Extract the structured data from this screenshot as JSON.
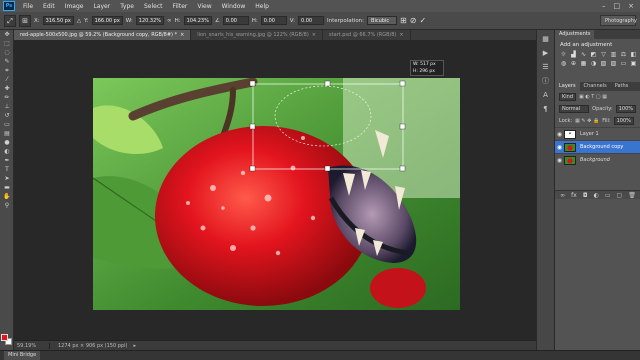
{
  "menu": {
    "logo": "Ps",
    "items": [
      "File",
      "Edit",
      "Image",
      "Layer",
      "Type",
      "Select",
      "Filter",
      "View",
      "Window",
      "Help"
    ],
    "window_controls": [
      "–",
      "□",
      "×"
    ]
  },
  "options": {
    "x_label": "X:",
    "x_value": "316.50 px",
    "y_label": "Y:",
    "y_value": "166.00 px",
    "w_label": "W:",
    "w_value": "120.32%",
    "h_label": "H:",
    "h_value": "104.23%",
    "angle_value": "0.00",
    "hskew_label": "H:",
    "hskew_value": "0.00",
    "vskew_label": "V:",
    "vskew_value": "0.00",
    "interp_label": "Interpolation:",
    "interp_value": "Bicubic",
    "workspace": "Photography"
  },
  "tabs": [
    {
      "label": "red-apple-500x500.jpg @ 59.2% (Background copy, RGB/8#) *",
      "active": true
    },
    {
      "label": "lion_snarls_his_warning.jpg @ 122% (RGB/8)",
      "active": false
    },
    {
      "label": "start.psd @ 66.7% (RGB/8)",
      "active": false
    }
  ],
  "canvas": {
    "transform_readout_w": "W: 517 px",
    "transform_readout_h": "H: 296 px"
  },
  "status": {
    "zoom": "59.19%",
    "doc_info": "1274 px × 906 px (150 ppi)"
  },
  "minibridge": "Mini Bridge",
  "adjustments": {
    "tab": "Adjustments",
    "title": "Add an adjustment"
  },
  "layers": {
    "tabs": [
      "Layers",
      "Channels",
      "Paths"
    ],
    "kind": "Kind",
    "blend_mode": "Normal",
    "opacity_label": "Opacity:",
    "opacity_value": "100%",
    "lock_label": "Lock:",
    "fill_label": "Fill:",
    "fill_value": "100%",
    "rows": [
      {
        "name": "Layer 1",
        "active": false
      },
      {
        "name": "Background copy",
        "active": true
      },
      {
        "name": "Background",
        "active": false
      }
    ]
  },
  "colors": {
    "foreground": "#e3141e",
    "background": "#ffffff",
    "selection": "#3874d0"
  }
}
